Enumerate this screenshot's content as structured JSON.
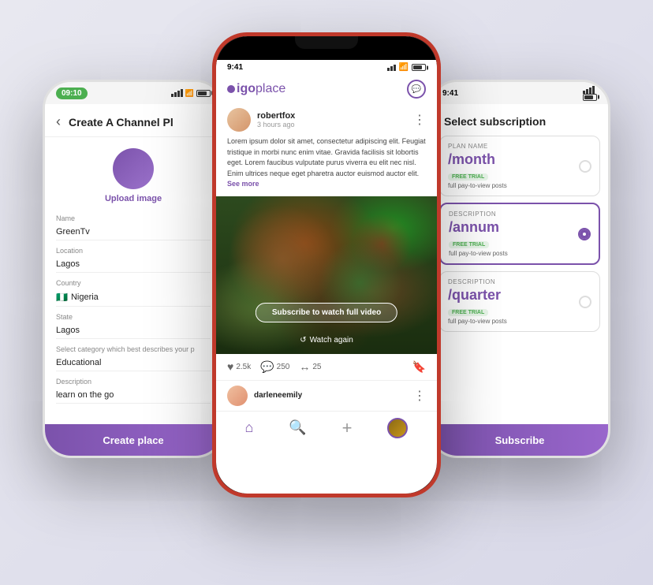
{
  "app": {
    "name": "igoplace",
    "logo_prefix": "igo",
    "logo_suffix": "place"
  },
  "left_phone": {
    "status_time": "09:10",
    "title": "Create A Channel Pl",
    "back_label": "‹",
    "upload_label": "Upload image",
    "fields": [
      {
        "label": "Name",
        "value": "GreenTv"
      },
      {
        "label": "Location",
        "value": "Lagos"
      },
      {
        "label": "Country",
        "value": "Nigeria",
        "flag": "🇳🇬"
      },
      {
        "label": "State",
        "value": "Lagos"
      },
      {
        "label": "Select category which best describes your p",
        "value": "Educational"
      },
      {
        "label": "Description",
        "value": "learn on the go"
      }
    ],
    "create_button": "Create place"
  },
  "center_phone": {
    "status_time": "9:41",
    "author": "robertfox",
    "time_ago": "3 hours ago",
    "post_text": "Lorem ipsum dolor sit amet, consectetur adipiscing elit. Feugiat tristique in morbi nunc enim vitae. Gravida facilisis sit lobortis eget. Lorem faucibus vulputate purus viverra eu elit nec nisl. Enim ultrices neque eget pharetra auctor euismod auctor elit.",
    "see_more": "See more",
    "subscribe_btn": "Subscribe to watch full video",
    "watch_again": "Watch again",
    "likes": "2.5k",
    "comments": "250",
    "shares": "25",
    "bottom_author": "darleneemily"
  },
  "right_phone": {
    "status_time": "9:41",
    "title": "Select subscription",
    "plans": [
      {
        "label": "PLAN NAME",
        "price": "/month",
        "trial": "FREE TRIAL",
        "desc": "full pay-to-view posts",
        "selected": false
      },
      {
        "label": "DESCRIPTION",
        "price": "/annum",
        "trial": "FREE TRIAL",
        "desc": "full pay-to-view posts",
        "selected": true
      },
      {
        "label": "DESCRIPTION",
        "price": "/quarter",
        "trial": "FREE TRIAL",
        "desc": "full pay-to-view posts",
        "selected": false
      }
    ],
    "subscribe_button": "Subscribe"
  }
}
